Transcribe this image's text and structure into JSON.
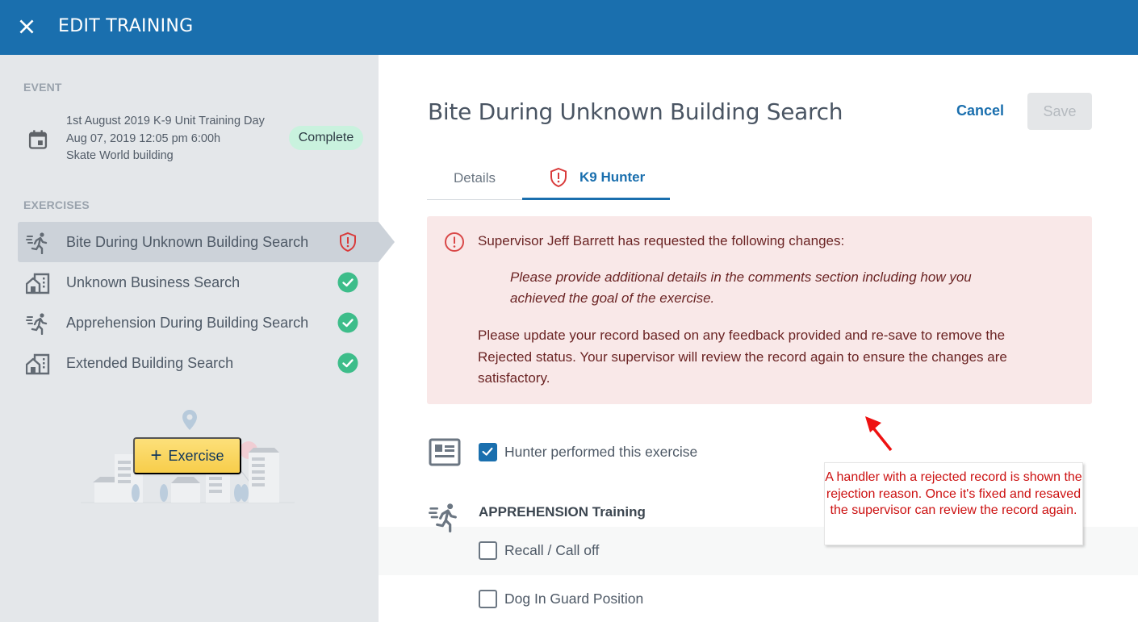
{
  "header": {
    "title": "EDIT TRAINING",
    "close_icon": "close-icon"
  },
  "sidebar": {
    "event_label": "EVENT",
    "event": {
      "icon": "calendar-icon",
      "name": "1st August 2019 K-9 Unit Training Day",
      "datetime": "Aug 07, 2019 12:05 pm 6:00h",
      "location": "Skate World building",
      "status": "Complete"
    },
    "exercises_label": "EXERCISES",
    "exercises": [
      {
        "label": "Bite During Unknown Building Search",
        "icon": "running-person-icon",
        "status": "rejected",
        "active": true
      },
      {
        "label": "Unknown Business Search",
        "icon": "building-icon",
        "status": "complete",
        "active": false
      },
      {
        "label": "Apprehension During Building Search",
        "icon": "running-person-icon",
        "status": "complete",
        "active": false
      },
      {
        "label": "Extended Building Search",
        "icon": "building-icon",
        "status": "complete",
        "active": false
      }
    ],
    "add_exercise_label": "Exercise"
  },
  "main": {
    "title": "Bite During Unknown Building Search",
    "cancel_label": "Cancel",
    "save_label": "Save",
    "tabs": [
      {
        "label": "Details",
        "active": false
      },
      {
        "label": "K9 Hunter",
        "active": true,
        "icon": "shield-alert-icon"
      }
    ],
    "alert": {
      "heading": "Supervisor Jeff Barrett has requested the following changes:",
      "quote": "Please provide additional details in the comments section including how you achieved the goal of the exercise.",
      "body": "Please update your record based on any feedback provided and re-save to remove the Rejected status. Your supervisor will review the record again to ensure the changes are satisfactory."
    },
    "performed": {
      "label": "Hunter performed this exercise",
      "checked": true
    },
    "section_title": "APPREHENSION Training",
    "items": [
      {
        "label": "Recall / Call off",
        "checked": false
      },
      {
        "label": "Dog In Guard Position",
        "checked": false
      }
    ]
  },
  "annotation": {
    "text": "A handler with a rejected record is shown the rejection reason. Once it's fixed and resaved the supervisor can review the record again.",
    "color": "#cc1010"
  },
  "colors": {
    "brand": "#1a6fae",
    "complete": "#3dbd8a",
    "rejected": "#d93a3a",
    "alert_bg": "#f9e8e8"
  }
}
